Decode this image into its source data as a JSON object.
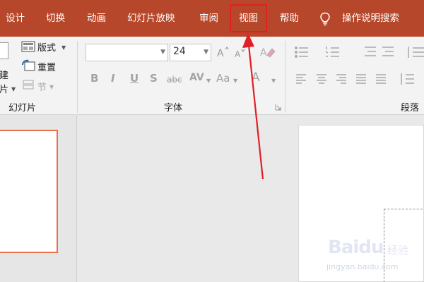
{
  "tabs": [
    {
      "label": "设计"
    },
    {
      "label": "切换"
    },
    {
      "label": "动画"
    },
    {
      "label": "幻灯片放映"
    },
    {
      "label": "审阅"
    },
    {
      "label": "视图"
    },
    {
      "label": "帮助"
    }
  ],
  "tell_me": {
    "label": "操作说明搜索",
    "icon": "lightbulb-icon"
  },
  "highlighted_tab": "视图",
  "slides_group": {
    "new_slide_partial_top": "建",
    "new_slide_partial_bottom": "片",
    "layout_label": "版式",
    "reset_label": "重置",
    "section_label": "节",
    "group_label": "幻灯片"
  },
  "font_group": {
    "font_name": "",
    "font_size": "24",
    "group_label": "字体",
    "buttons": [
      "B",
      "I",
      "U",
      "S",
      "abc",
      "AV",
      "Aa",
      "A"
    ]
  },
  "paragraph_group": {
    "group_label": "段落"
  },
  "watermark": {
    "brand": "Baidu",
    "suffix": "经验",
    "url": "jingyan.baidu.com"
  },
  "colors": {
    "accent": "#b7472a",
    "highlight_box": "#e02020",
    "slide_selected_border": "#e8704c"
  }
}
